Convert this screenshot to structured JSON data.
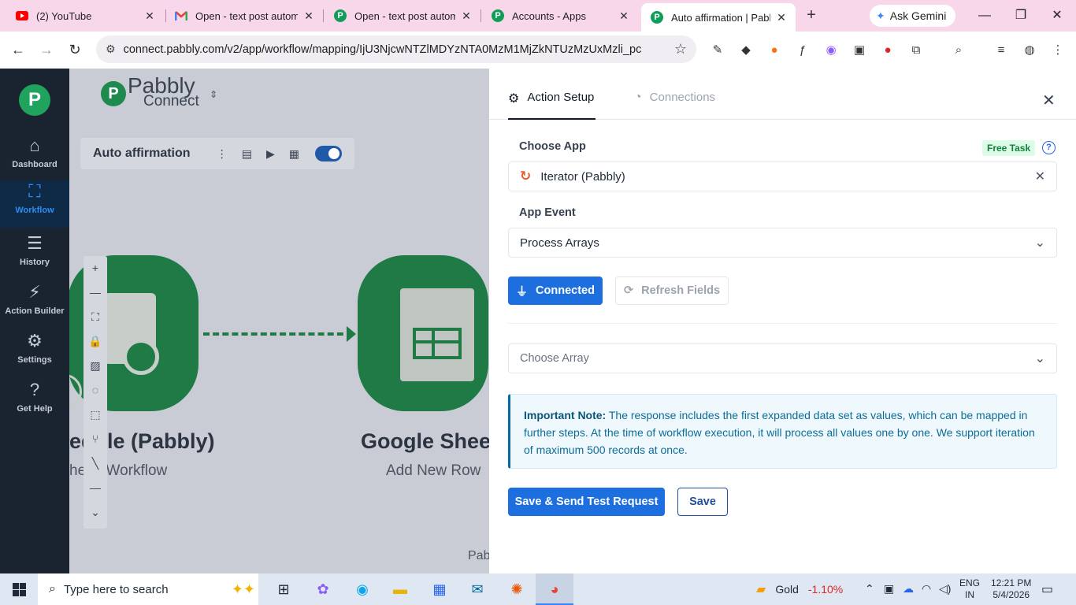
{
  "browser": {
    "tabs": [
      {
        "title": "(2) YouTube",
        "icon": "youtube-icon"
      },
      {
        "title": "Open - text post automa",
        "icon": "gmail-icon"
      },
      {
        "title": "Open - text post automa",
        "icon": "pabbly-icon"
      },
      {
        "title": "Accounts - Apps",
        "icon": "pabbly-icon"
      },
      {
        "title": "Auto affirmation | Pabbly",
        "icon": "pabbly-icon"
      }
    ],
    "gemini_label": "Ask Gemini",
    "url": "connect.pabbly.com/v2/app/workflow/mapping/IjU3NjcwNTZlMDYzNTA0MzM1MjZkNTUzMzUxMzli_pc"
  },
  "sidebar": {
    "items": [
      {
        "label": "Dashboard",
        "icon": "home-icon"
      },
      {
        "label": "Workflow",
        "icon": "workflow-icon"
      },
      {
        "label": "History",
        "icon": "history-icon"
      },
      {
        "label": "Action Builder",
        "icon": "bolt-icon"
      },
      {
        "label": "Settings",
        "icon": "gear-icon"
      },
      {
        "label": "Get Help",
        "icon": "help-icon"
      }
    ]
  },
  "canvas": {
    "brand_line1": "Pabbly",
    "brand_line2": "Connect",
    "workflow_name": "Auto affirmation",
    "node1_title": "edule (Pabbly)",
    "node1_sub": "he  le Workflow",
    "node2_title": "Google Shee",
    "node2_sub": "Add New Row",
    "footer_text": "Pab"
  },
  "panel": {
    "tab_action": "Action Setup",
    "tab_connections": "Connections",
    "choose_app_label": "Choose App",
    "free_task": "Free Task",
    "app_value": "Iterator (Pabbly)",
    "app_event_label": "App Event",
    "app_event_value": "Process Arrays",
    "connected_label": "Connected",
    "refresh_label": "Refresh Fields",
    "choose_array_placeholder": "Choose Array",
    "note_title": "Important Note:",
    "note_body": " The response includes the first expanded data set as values, which can be mapped in further steps. At the time of workflow execution, it will process all values one by one. We support iteration of maximum 500 records at once.",
    "save_send_label": "Save & Send Test Request",
    "save_label": "Save"
  },
  "taskbar": {
    "search_placeholder": "Type here to search",
    "gold_label": "Gold",
    "gold_change": "-1.10%",
    "lang_line1": "ENG",
    "lang_line2": "IN",
    "time": "12:21 PM",
    "date": "5/4/2026"
  }
}
